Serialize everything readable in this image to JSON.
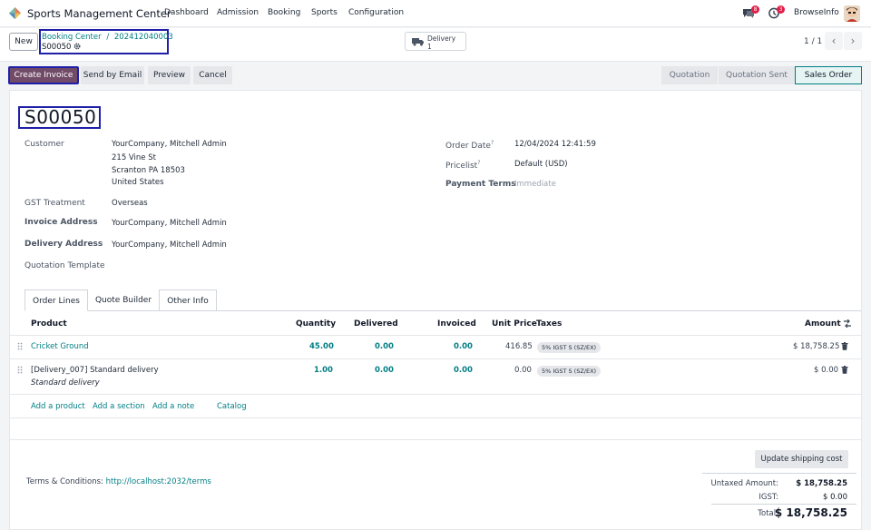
{
  "topbar": {
    "app_title": "Sports Management Center",
    "menu": [
      "Dashboard",
      "Admission",
      "Booking",
      "Sports",
      "Configuration"
    ],
    "messages_count": "8",
    "activities_count": "3",
    "company": "BrowseInfo"
  },
  "control": {
    "new_label": "New",
    "breadcrumb_parent": "Booking Center",
    "breadcrumb_sep": "/",
    "breadcrumb_record": "202412040003",
    "record_name": "S00050",
    "delivery_label": "Delivery",
    "delivery_count": "1",
    "pager": "1 / 1"
  },
  "actions": {
    "create_invoice": "Create Invoice",
    "send_email": "Send by Email",
    "preview": "Preview",
    "cancel": "Cancel"
  },
  "stages": [
    "Quotation",
    "Quotation Sent",
    "Sales Order"
  ],
  "active_stage": "Sales Order",
  "order": {
    "name": "S00050",
    "customer_label": "Customer",
    "customer": "YourCompany, Mitchell Admin",
    "address_line1": "215 Vine St",
    "address_line2": "Scranton PA 18503",
    "address_line3": "United States",
    "gst_label": "GST Treatment",
    "gst": "Overseas",
    "invoice_address_label": "Invoice Address",
    "invoice_address": "YourCompany, Mitchell Admin",
    "delivery_address_label": "Delivery Address",
    "delivery_address": "YourCompany, Mitchell Admin",
    "quotation_template_label": "Quotation Template",
    "order_date_label": "Order Date",
    "order_date": "12/04/2024 12:41:59",
    "pricelist_label": "Pricelist",
    "pricelist": "Default (USD)",
    "payment_terms_label": "Payment Terms",
    "payment_terms_placeholder": "Immediate"
  },
  "tabs": [
    "Order Lines",
    "Quote Builder",
    "Other Info"
  ],
  "table": {
    "headers": {
      "product": "Product",
      "quantity": "Quantity",
      "delivered": "Delivered",
      "invoiced": "Invoiced",
      "unit_price": "Unit Price",
      "taxes": "Taxes",
      "amount": "Amount"
    },
    "rows": [
      {
        "product": "Cricket Ground",
        "description": "",
        "quantity": "45.00",
        "delivered": "0.00",
        "invoiced": "0.00",
        "unit_price": "416.85",
        "tax": "5% IGST S (SZ/EX)",
        "amount": "$ 18,758.25"
      },
      {
        "product": "[Delivery_007] Standard delivery",
        "description": "Standard delivery",
        "quantity": "1.00",
        "delivered": "0.00",
        "invoiced": "0.00",
        "unit_price": "0.00",
        "tax": "5% IGST S (SZ/EX)",
        "amount": "$ 0.00"
      }
    ],
    "add_product": "Add a product",
    "add_section": "Add a section",
    "add_note": "Add a note",
    "catalog": "Catalog"
  },
  "footer": {
    "update_shipping": "Update shipping cost",
    "terms_label": "Terms & Conditions:",
    "terms_link": "http://localhost:2032/terms",
    "untaxed_label": "Untaxed Amount:",
    "untaxed": "$ 18,758.25",
    "igst_label": "IGST:",
    "igst": "$ 0.00",
    "total_label": "Total:",
    "total": "$ 18,758.25"
  },
  "colors": {
    "primary": "#714b67",
    "link": "#017e84",
    "highlight_box": "#1f1fa8"
  }
}
